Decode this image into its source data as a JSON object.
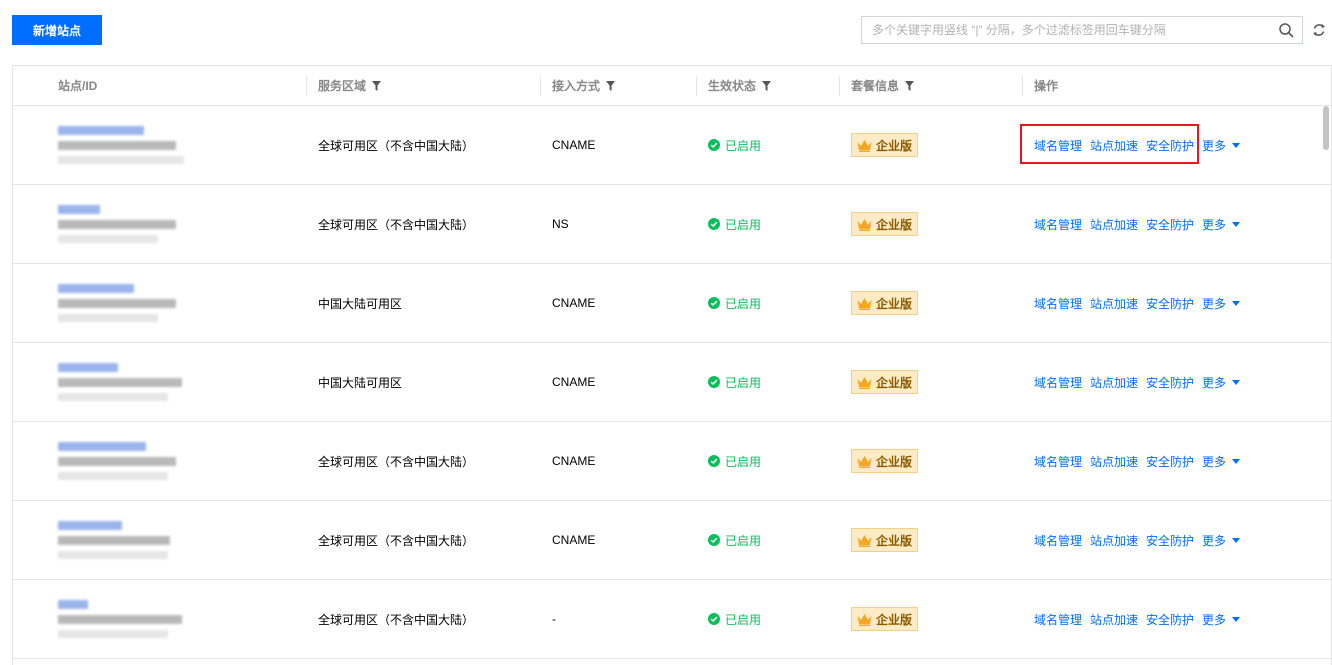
{
  "toolbar": {
    "add_site_label": "新增站点",
    "search_placeholder": "多个关键字用竖线 “|” 分隔，多个过滤标签用回车键分隔",
    "search_value": ""
  },
  "table": {
    "columns": [
      {
        "label": "站点/ID",
        "filterable": false
      },
      {
        "label": "服务区域",
        "filterable": true
      },
      {
        "label": "接入方式",
        "filterable": true
      },
      {
        "label": "生效状态",
        "filterable": true
      },
      {
        "label": "套餐信息",
        "filterable": true
      },
      {
        "label": "操作",
        "filterable": false
      }
    ],
    "actions": {
      "domain_mgmt": "域名管理",
      "site_accel": "站点加速",
      "security": "安全防护",
      "more": "更多"
    },
    "rows": [
      {
        "region": "全球可用区（不含中国大陆）",
        "access": "CNAME",
        "status": "已启用",
        "plan": "企业版"
      },
      {
        "region": "全球可用区（不含中国大陆）",
        "access": "NS",
        "status": "已启用",
        "plan": "企业版"
      },
      {
        "region": "中国大陆可用区",
        "access": "CNAME",
        "status": "已启用",
        "plan": "企业版"
      },
      {
        "region": "中国大陆可用区",
        "access": "CNAME",
        "status": "已启用",
        "plan": "企业版"
      },
      {
        "region": "全球可用区（不含中国大陆）",
        "access": "CNAME",
        "status": "已启用",
        "plan": "企业版"
      },
      {
        "region": "全球可用区（不含中国大陆）",
        "access": "CNAME",
        "status": "已启用",
        "plan": "企业版"
      },
      {
        "region": "全球可用区（不含中国大陆）",
        "access": "-",
        "status": "已启用",
        "plan": "企业版"
      }
    ]
  },
  "colors": {
    "primary": "#006eff",
    "status_green": "#0abf5b",
    "badge_bg": "#fcebc4",
    "highlight_red": "#e5191f"
  },
  "icons": {
    "search": "search-icon",
    "refresh": "refresh-icon",
    "filter": "filter-icon",
    "status": "check-circle-icon",
    "plan": "crown-icon",
    "more": "caret-down-icon"
  }
}
